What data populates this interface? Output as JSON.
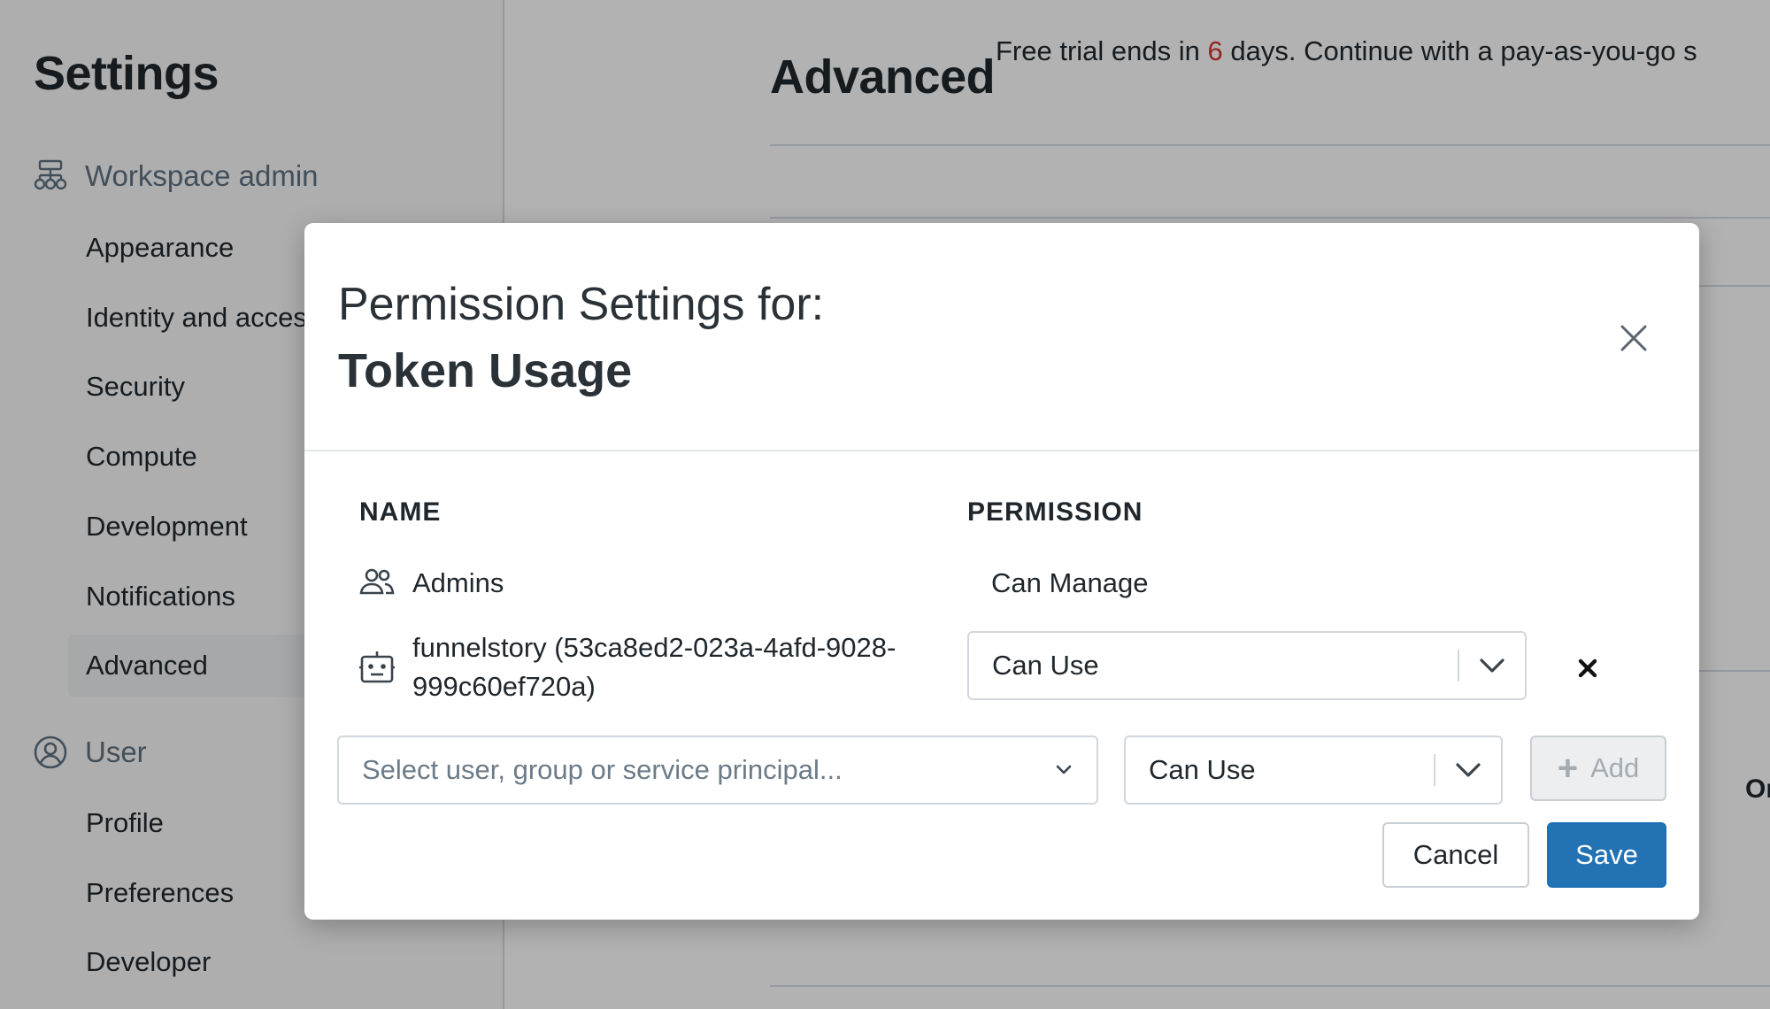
{
  "sidebar": {
    "title": "Settings",
    "sections": [
      {
        "label": "Workspace admin",
        "icon": "workspace-admin-icon",
        "items": [
          "Appearance",
          "Identity and access",
          "Security",
          "Compute",
          "Development",
          "Notifications",
          "Advanced"
        ]
      },
      {
        "label": "User",
        "icon": "user-circle-icon",
        "items": [
          "Profile",
          "Preferences",
          "Developer"
        ]
      }
    ],
    "active_item": "Advanced"
  },
  "main": {
    "title": "Advanced",
    "trial_prefix": "Free trial ends in ",
    "trial_days": "6",
    "trial_suffix": " days. Continue with a pay-as-you-go s",
    "edge_text": "Or"
  },
  "modal": {
    "subtitle": "Permission Settings for:",
    "title": "Token Usage",
    "columns": {
      "name": "NAME",
      "permission": "PERMISSION"
    },
    "rows": [
      {
        "icon": "group-icon",
        "name": "Admins",
        "permission": "Can Manage",
        "editable": false
      },
      {
        "icon": "robot-icon",
        "name": "funnelstory (53ca8ed2-023a-4afd-9028-999c60ef720a)",
        "permission": "Can Use",
        "editable": true
      }
    ],
    "add_row": {
      "principal_placeholder": "Select user, group or service principal...",
      "permission": "Can Use",
      "add_label": "Add"
    },
    "buttons": {
      "cancel": "Cancel",
      "save": "Save"
    }
  },
  "colors": {
    "accent": "#2272b4",
    "trial_days": "#d3342b",
    "overlay": "rgba(0,0,0,0.30)"
  }
}
